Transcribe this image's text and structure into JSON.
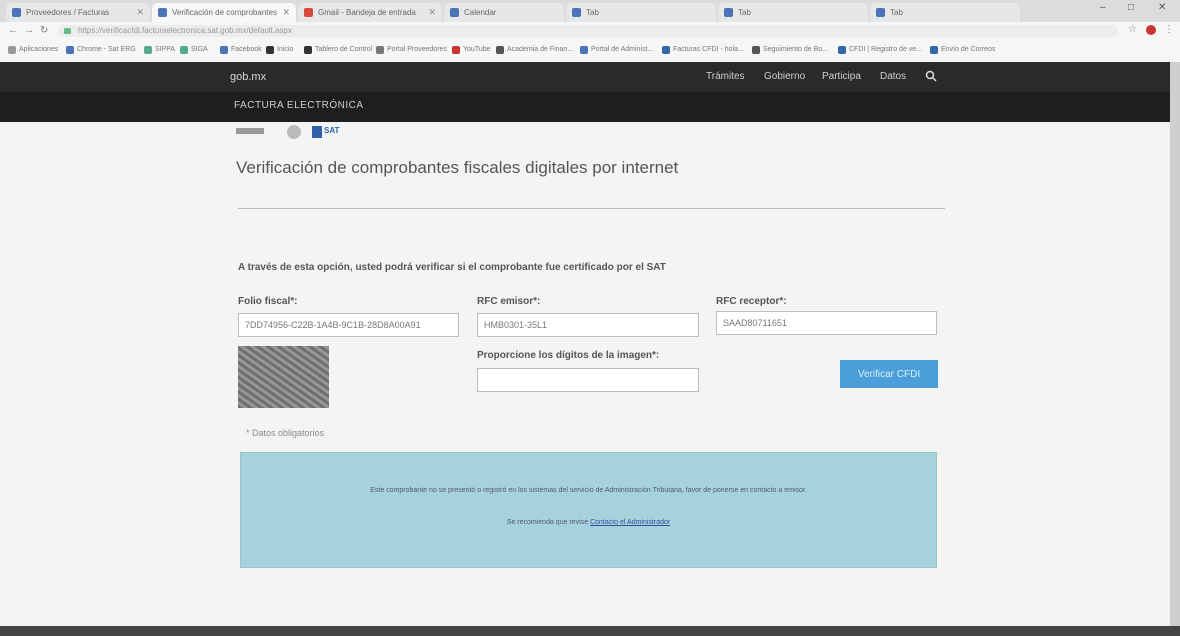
{
  "browser": {
    "tabs": [
      {
        "label": "Proveedores / Facturas",
        "color": "#4a73b8"
      },
      {
        "label": "Verificación de comprobantes",
        "color": "#4a73b8"
      },
      {
        "label": "Gmail - Bandeja de entrada",
        "color": "#d94a3d"
      },
      {
        "label": "Calendar",
        "color": "#4a73b8"
      },
      {
        "label": "Tab",
        "color": "#4a73b8"
      },
      {
        "label": "Tab",
        "color": "#4a73b8"
      },
      {
        "label": "Tab",
        "color": "#4a73b8"
      }
    ],
    "url": "https://verificacfdi.facturaelectronica.sat.gob.mx/default.aspx",
    "bookmarks": [
      "Aplicaciones",
      "Chrome - Sat ERG",
      "SIPPA",
      "SIGA",
      "Facebook",
      "Inicio",
      "Tablero de Control",
      "Portal Proveedores",
      "YouTube",
      "Academia de Finan...",
      "Portal de Administ...",
      "Facturas CFDI - hola...",
      "Seguimiento de Bo...",
      "CFDI | Registro de ve...",
      "Envío de Correos"
    ]
  },
  "header": {
    "brand": "gob.mx",
    "nav": [
      "Trámites",
      "Gobierno",
      "Participa",
      "Datos"
    ],
    "subtitle": "FACTURA ELECTRÓNICA"
  },
  "page": {
    "logos": "SAT",
    "title": "Verificación de comprobantes fiscales digitales por internet",
    "instruction": "A través de esta opción, usted podrá verificar si el comprobante fue certificado por el SAT",
    "folio_label": "Folio fiscal*:",
    "folio_value": "7DD74956-C22B-1A4B-9C1B-28D8A00A91",
    "rfc_emisor_label": "RFC emisor*:",
    "rfc_emisor_value": "HMB0301-35L1",
    "rfc_receptor_label": "RFC receptor*:",
    "rfc_receptor_value": "SAAD80711651",
    "captcha_label": "Proporcione los dígitos de la imagen*:",
    "captcha_value": "",
    "verify_button": "Verificar CFDI",
    "required_note": "* Datos obligatorios",
    "info_line1": "Este comprobante no se presentó o registró en los sistemas del servicio de Administración Tributaria, favor de ponerse en contacto a emisor.",
    "info_line2_prefix": "Se recomienda que revise ",
    "info_line2_link": "Contacto el Administrador"
  }
}
